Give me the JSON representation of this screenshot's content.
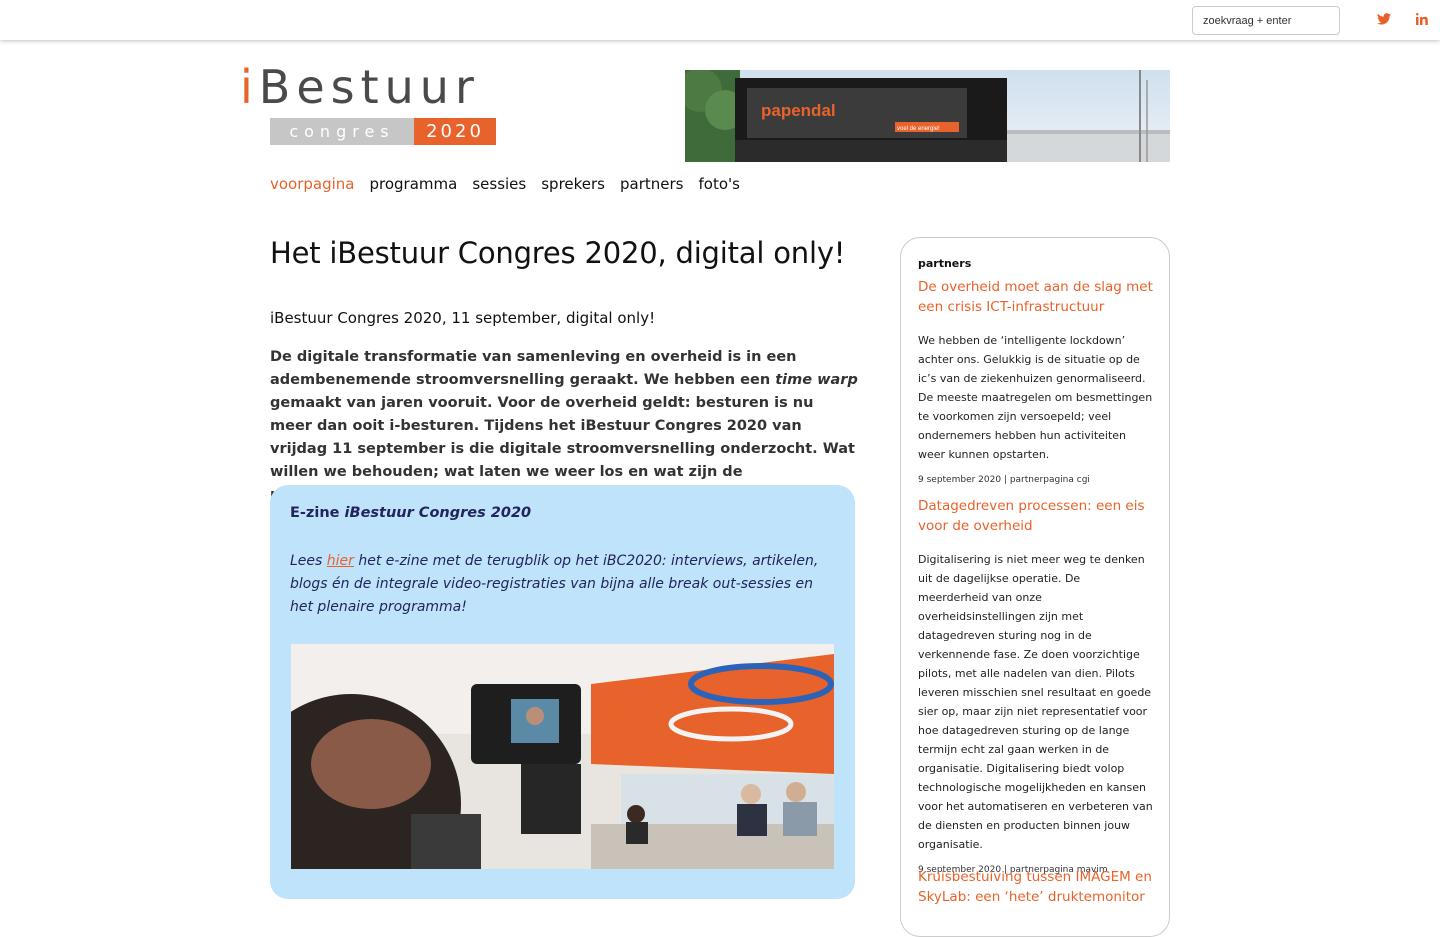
{
  "topbar": {
    "search_placeholder": "zoekvraag + enter",
    "social": [
      {
        "icon": "twitter-icon",
        "color": "#e8632b"
      },
      {
        "icon": "linkedin-icon",
        "color": "#e8632b"
      }
    ]
  },
  "logo": {
    "i": "i",
    "brand": "Bestuur",
    "sub": "congres",
    "year": "2020"
  },
  "nav": {
    "items": [
      {
        "label": "voorpagina",
        "active": true
      },
      {
        "label": "programma"
      },
      {
        "label": "sessies"
      },
      {
        "label": "sprekers"
      },
      {
        "label": "partners"
      },
      {
        "label": "foto's"
      }
    ]
  },
  "main": {
    "title": "Het iBestuur Congres 2020, digital only!",
    "subtitle": "iBestuur Congres 2020, 11 september, digital only!",
    "intro_part1": "De digitale transformatie van samenleving en overheid is in een adembenemende stroomversnelling geraakt. We hebben een ",
    "intro_em": "time warp",
    "intro_part2": " gemaakt van jaren vooruit. Voor de overheid geldt: besturen is nu meer dan ooit i-besturen. Tijdens het iBestuur Congres 2020 van vrijdag 11 september is die digitale stroomversnelling onderzocht. Wat willen we behouden; wat laten we weer los en wat zijn de randvoorwaarden?",
    "ezine": {
      "title_prefix": "E-zine ",
      "title_em": "iBestuur Congres 2020",
      "text_before": "Lees ",
      "link": "hier",
      "text_after": " het e-zine met de terugblik op het iBC2020: interviews, artikelen, blogs én de integrale video-registraties van bijna alle break out-sessies en het plenaire programma!"
    }
  },
  "sidebar": {
    "heading": "partners",
    "articles": [
      {
        "title": "De overheid moet aan de slag met een crisis ICT-infrastructuur",
        "body": "We hebben de ‘intelligente lockdown’ achter ons. Gelukkig is de situatie op de ic’s van de ziekenhuizen genormaliseerd. De meeste maatregelen om besmettingen te voorkomen zijn versoepeld; veel ondernemers hebben hun activiteiten weer kunnen opstarten.",
        "meta": "9 september 2020 | partnerpagina cgi"
      },
      {
        "title": "Datagedreven processen: een eis voor de overheid",
        "body": "Digitalisering is niet meer weg te denken uit de dagelijkse operatie. De meerderheid van onze overheidsinstellingen zijn met datagedreven sturing nog in de verkennende fase. Ze doen voorzichtige pilots, met alle nadelen van dien. Pilots leveren misschien snel resultaat en goede sier op, maar zijn niet representatief voor hoe datagedreven sturing op de lange termijn echt zal gaan werken in de organisatie. Digitalisering biedt volop technologische mogelijkheden en kansen voor het automatiseren en verbeteren van de diensten en producten binnen jouw organisatie.",
        "meta": "9 september 2020 | partnerpagina mavim"
      },
      {
        "title": "Kruisbestuiving tussen IMAGEM en SkyLab: een ‘hete’ druktemonitor",
        "body": "",
        "meta": ""
      }
    ]
  },
  "images": {
    "banner_sign": "papendal",
    "banner_slogan": "voel de energie!",
    "colors": {
      "accent": "#e8632b",
      "ezine_bg": "#bfe3fb",
      "ezine_text": "#23245e"
    }
  }
}
